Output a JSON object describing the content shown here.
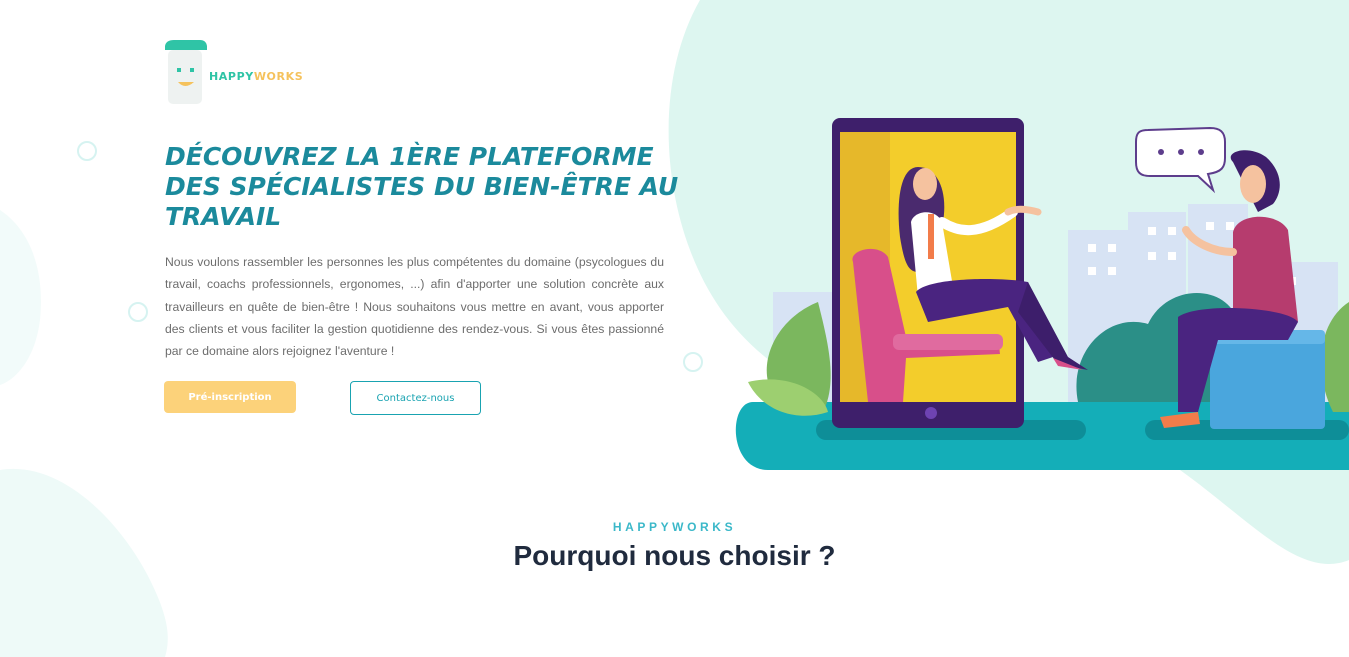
{
  "brand": {
    "name_part1": "HAPPY",
    "name_part2": "WORKS",
    "logo_icon": "coffee-cup-smiley-icon",
    "colors": {
      "teal": "#2fc4a6",
      "yellow": "#f5c25c"
    }
  },
  "hero": {
    "title": "Découvrez la 1ère plateforme des spécialistes du bien-être au travail",
    "description": "Nous voulons rassembler les personnes les plus compétentes du domaine (psycologues du travail, coachs professionnels, ergonomes, ...) afin d'apporter une solution concrète aux travailleurs en quête de bien-être ! Nous souhaitons vous mettre en avant, vous apporter des clients et vous faciliter la gestion quotidienne des rendez-vous. Si vous êtes passionné par ce domaine alors rejoignez l'aventure !",
    "primary_button": "Pré-inscription",
    "secondary_button": "Contactez-nous",
    "title_color": "#1b8a9c"
  },
  "section": {
    "eyebrow": "HAPPYWORKS",
    "title": "Pourquoi nous choisir ?"
  }
}
